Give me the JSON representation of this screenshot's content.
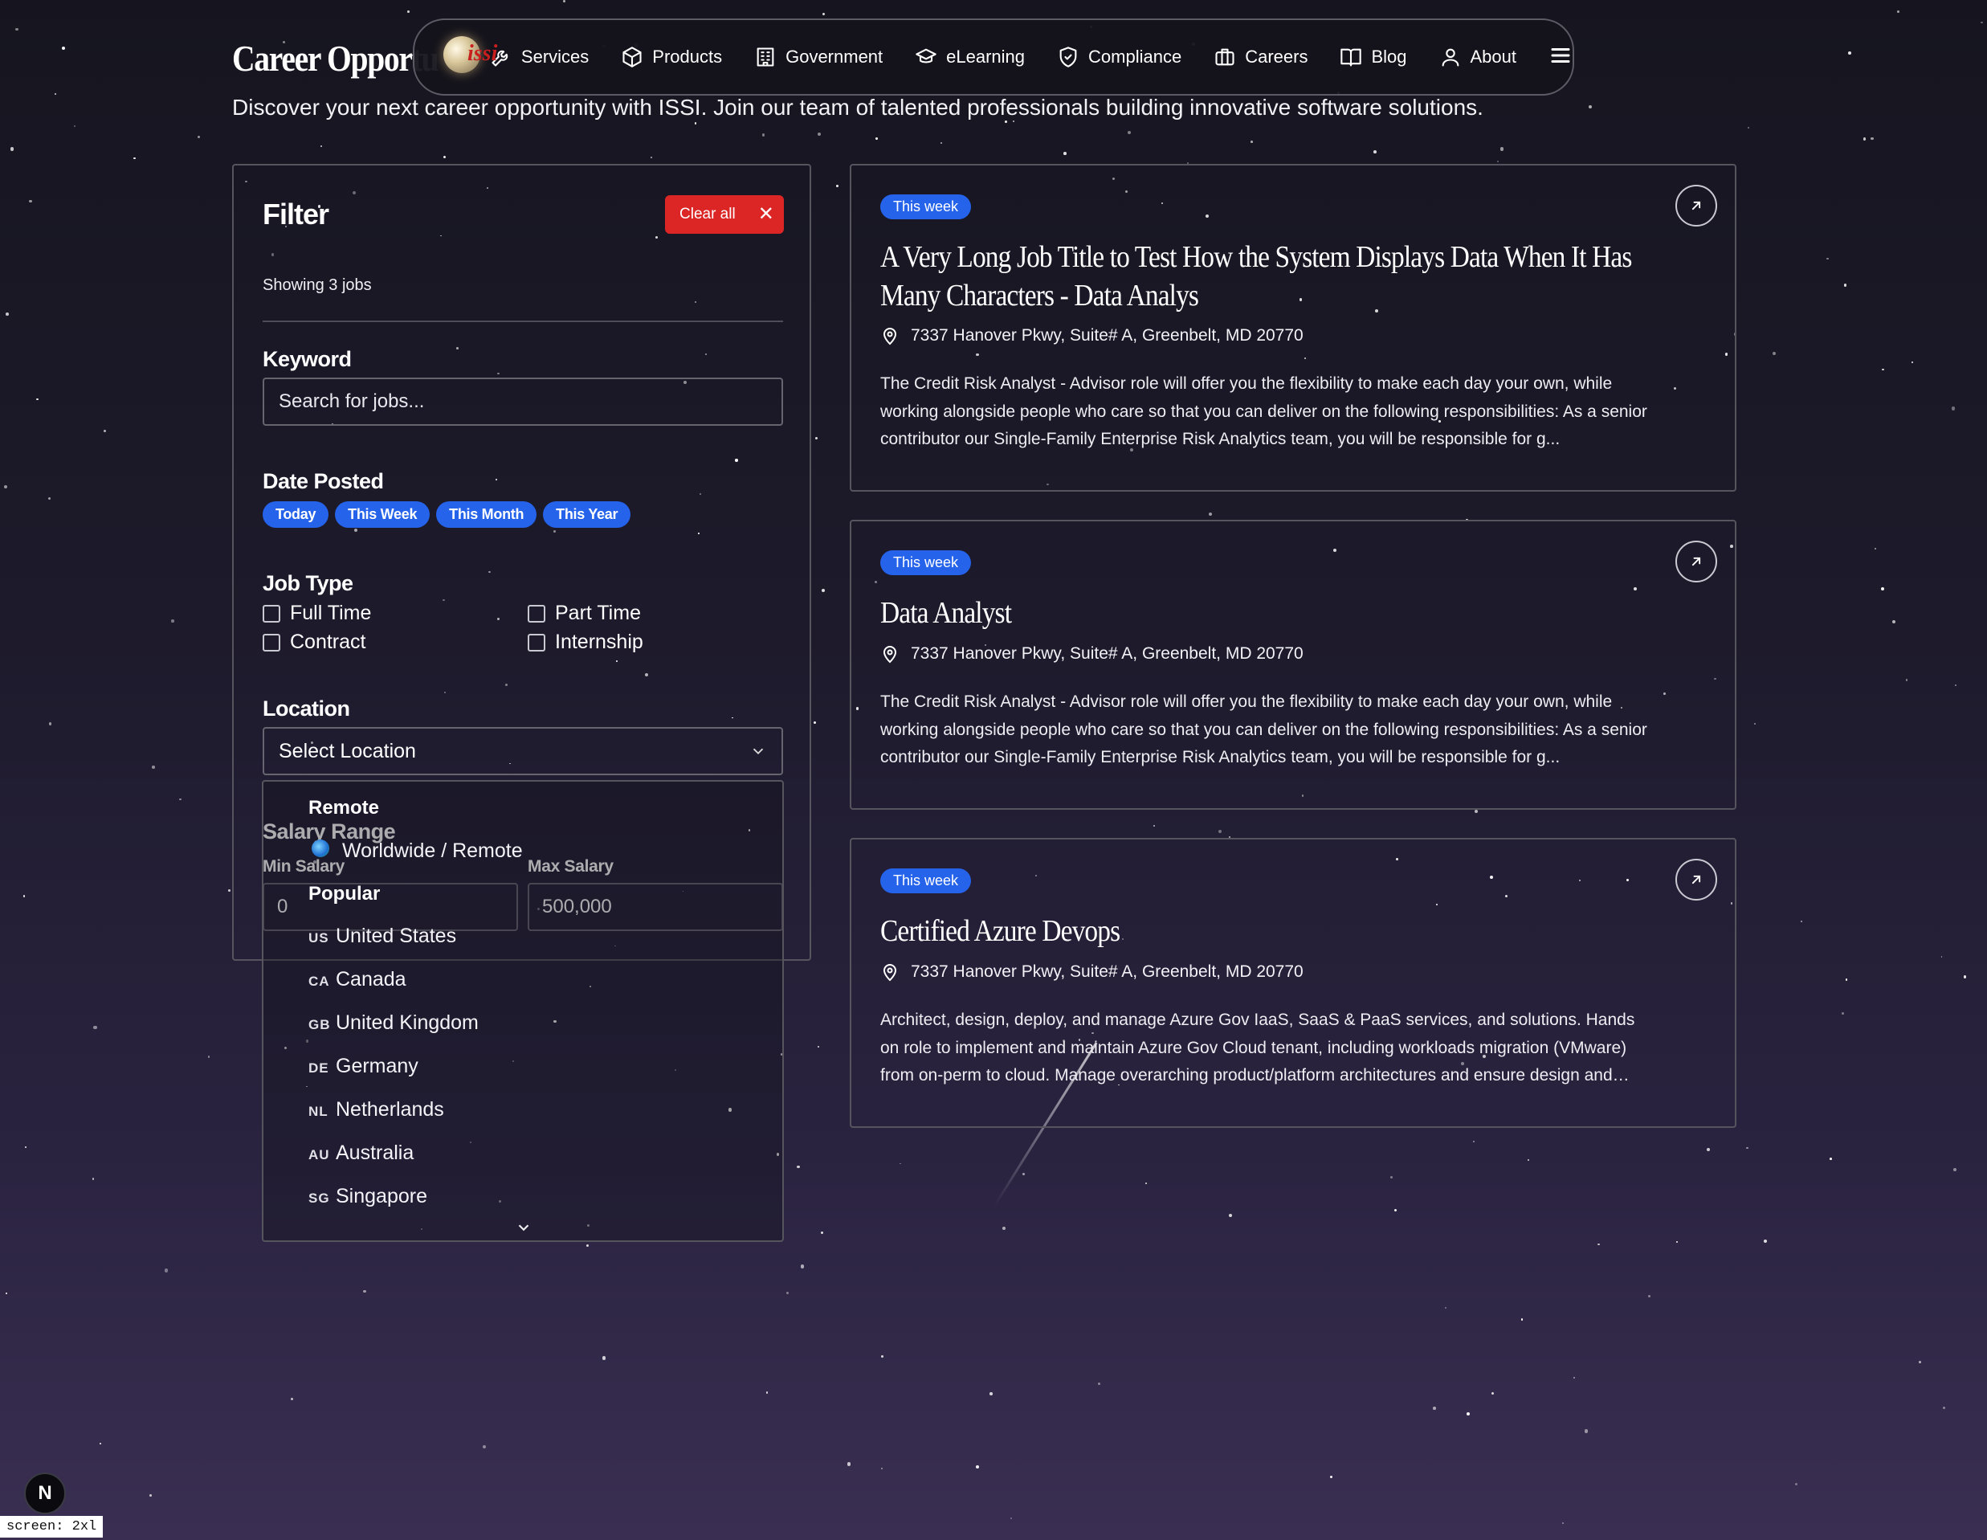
{
  "page": {
    "title": "Career Opportu",
    "subtitle": "Discover your next career opportunity with ISSI. Join our team of talented professionals building innovative software solutions."
  },
  "nav": {
    "logo_text": "issi",
    "items": [
      {
        "label": "Services",
        "icon": "wrench-icon"
      },
      {
        "label": "Products",
        "icon": "box-icon"
      },
      {
        "label": "Government",
        "icon": "building-icon"
      },
      {
        "label": "eLearning",
        "icon": "graduation-cap-icon"
      },
      {
        "label": "Compliance",
        "icon": "shield-check-icon"
      },
      {
        "label": "Careers",
        "icon": "briefcase-icon"
      },
      {
        "label": "Blog",
        "icon": "book-open-icon"
      },
      {
        "label": "About",
        "icon": "user-icon"
      }
    ],
    "menu_icon": "hamburger-menu-icon"
  },
  "filter": {
    "title": "Filter",
    "clear_label": "Clear all",
    "showing": "Showing 3 jobs",
    "keyword_label": "Keyword",
    "keyword_placeholder": "Search for jobs...",
    "date_label": "Date Posted",
    "date_options": [
      "Today",
      "This Week",
      "This Month",
      "This Year"
    ],
    "job_type_label": "Job Type",
    "job_types": [
      "Full Time",
      "Part Time",
      "Contract",
      "Internship"
    ],
    "location_label": "Location",
    "location_value": "Select Location",
    "salary_label": "Salary Range",
    "min_label": "Min Salary",
    "min_value": "0",
    "max_label": "Max Salary",
    "max_value": "500,000"
  },
  "location_dropdown": {
    "group_remote": "Remote",
    "remote_option": "Worldwide / Remote",
    "group_popular": "Popular",
    "countries": [
      {
        "code": "US",
        "name": "United States"
      },
      {
        "code": "CA",
        "name": "Canada"
      },
      {
        "code": "GB",
        "name": "United Kingdom"
      },
      {
        "code": "DE",
        "name": "Germany"
      },
      {
        "code": "NL",
        "name": "Netherlands"
      },
      {
        "code": "AU",
        "name": "Australia"
      },
      {
        "code": "SG",
        "name": "Singapore"
      }
    ]
  },
  "jobs": [
    {
      "badge": "This week",
      "title": "A Very Long Job Title to Test How the System Displays Data When It Has Many Characters - Data Analys",
      "location": "7337 Hanover Pkwy, Suite# A, Greenbelt, MD 20770",
      "description": "The Credit Risk Analyst - Advisor role will offer you the flexibility to make each day your own, while working alongside people who care so that you can deliver on the following responsibilities: As a senior contributor our Single-Family Enterprise Risk Analytics team, you will be responsible for g..."
    },
    {
      "badge": "This week",
      "title": "Data Analyst",
      "location": "7337 Hanover Pkwy, Suite# A, Greenbelt, MD 20770",
      "description": "The Credit Risk Analyst - Advisor role will offer you the flexibility to make each day your own, while working alongside people who care so that you can deliver on the following responsibilities: As a senior contributor our Single-Family Enterprise Risk Analytics team, you will be responsible for g..."
    },
    {
      "badge": "This week",
      "title": "Certified Azure Devops",
      "location": "7337 Hanover Pkwy, Suite# A, Greenbelt, MD 20770",
      "description": "Architect, design, deploy, and manage Azure Gov IaaS, SaaS & PaaS services, and solutions. Hands on role to implement and maintain Azure Gov Cloud tenant, including workloads migration (VMware) from on-perm to cloud. Manage overarching product/platform architectures and ensure design and development..."
    }
  ],
  "footer": {
    "dev_badge": "N",
    "screen_tag": "screen: 2xl"
  }
}
